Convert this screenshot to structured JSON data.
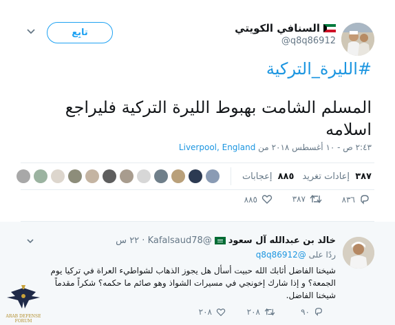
{
  "tweet": {
    "author_name": "السنافي الكويتي",
    "author_handle": "@q8q86912",
    "follow_label": "تابِع",
    "hashtag": "#الليرة_التركية",
    "text": "المسلم الشامت بهبوط الليرة التركية فليراجع اسلامه",
    "time": "٢:٤٣ ص - ١٠ أغسطس ٢٠١٨ من",
    "place": "Liverpool, England",
    "retweets_count": "٣٨٧",
    "retweets_label": "إعادات تغريد",
    "likes_count": "٨٨٥",
    "likes_label": "إعجابات",
    "likers_colors": [
      "#8a9bb4",
      "#2c3a52",
      "#b9a07a",
      "#6f7f8a",
      "#d7d7d7",
      "#a89c8e",
      "#5e5e5e",
      "#c4b4a2",
      "#8d8d7a",
      "#ddd6cd",
      "#9bb3a0",
      "#a8a8a8"
    ],
    "actions": {
      "replies": "٨٣٦",
      "retweets": "٣٨٧",
      "likes": "٨٨٥"
    }
  },
  "reply": {
    "author_name": "خالد بن عبدالله آل سعود",
    "author_handle": "@Kafalsaud78",
    "time": "٢٢ س",
    "reply_to_label": "ردًا على",
    "reply_to_handle": "@q8q86912",
    "text": "شيخنا الفاضل أثابك الله حبيت أسأل هل يجوز الذهاب لشواطيء العراة في تركيا يوم الجمعة؟ و إذا شارك إخونجي في مسيرات الشواذ وهو صائم ما حكمه؟ شكراً مقدماً شيخنا الفاضل.",
    "actions": {
      "replies": "٩٠",
      "retweets": "٢٠٨",
      "likes": "٢٠٨"
    }
  },
  "watermark_text": "ARAB DEFENSE FORUM",
  "colors": {
    "accent": "#1da1f2",
    "link": "#1b95e0",
    "muted": "#657786",
    "divider": "#e6ecf0"
  }
}
